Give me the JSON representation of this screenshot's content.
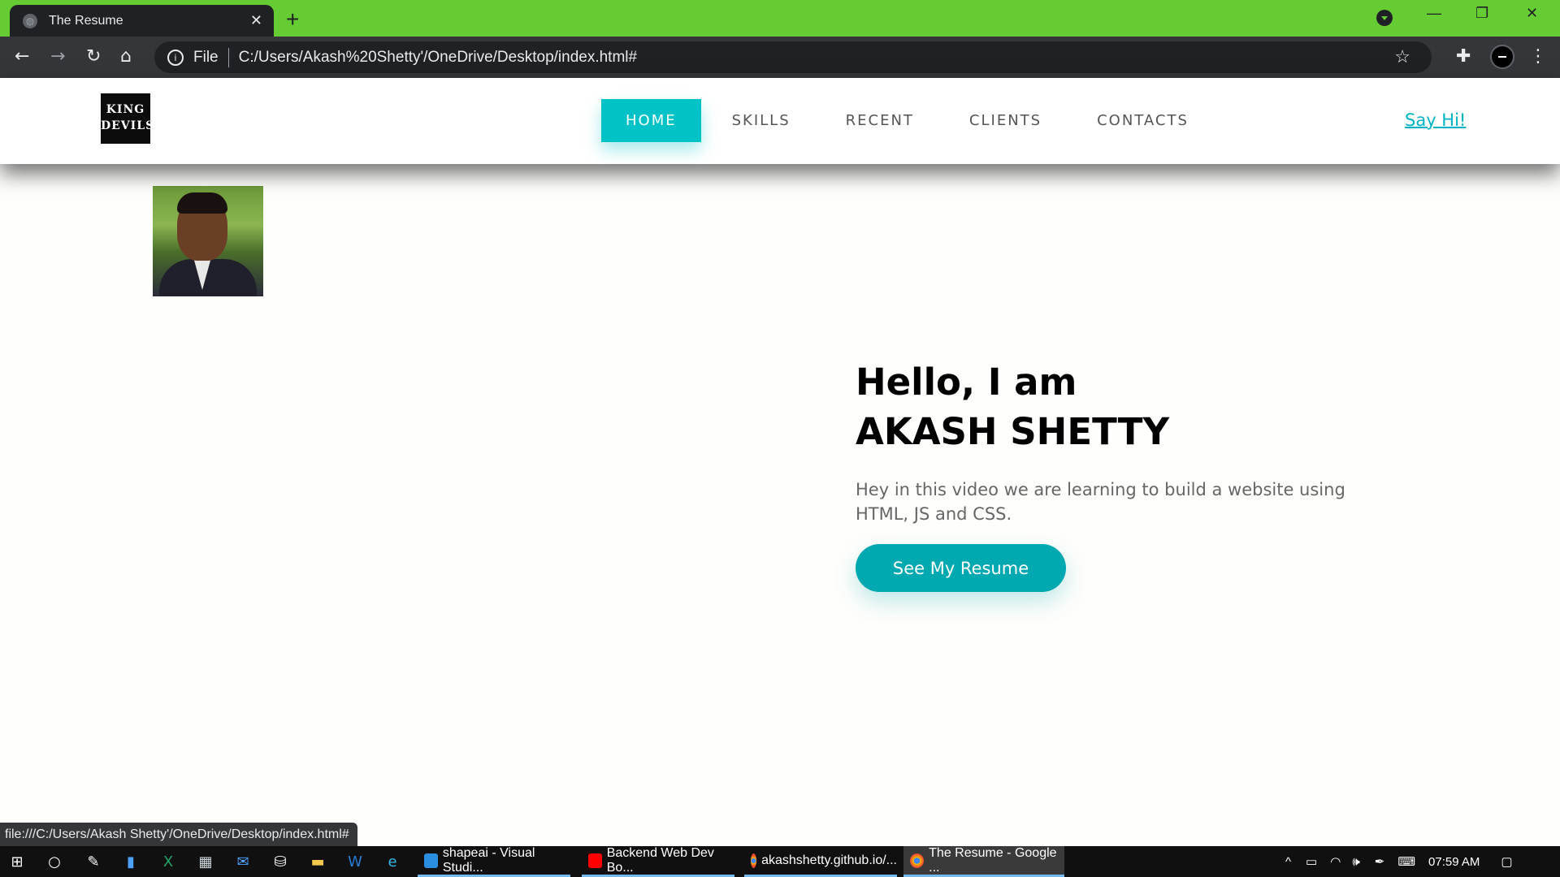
{
  "browser": {
    "tab_title": "The Resume",
    "tab_close": "✕",
    "new_tab": "+",
    "omnibox_scheme": "File",
    "url": "C:/Users/Akash%20Shetty'/OneDrive/Desktop/index.html#",
    "status_url": "file:///C:/Users/Akash Shetty'/OneDrive/Desktop/index.html#",
    "accent_color": "#66cc33"
  },
  "site": {
    "logo_line1": "KING",
    "logo_line2": "DEVILS",
    "nav": [
      {
        "label": "HOME",
        "active": true
      },
      {
        "label": "SKILLS",
        "active": false
      },
      {
        "label": "RECENT",
        "active": false
      },
      {
        "label": "CLIENTS",
        "active": false
      },
      {
        "label": "CONTACTS",
        "active": false
      }
    ],
    "say_hi": "Say Hi!",
    "accent_color": "#00c2c7"
  },
  "hero": {
    "greeting_line1": "Hello, I am",
    "greeting_line2": "AKASH SHETTY",
    "description": "Hey in this video we are learning to build a website using HTML, JS and CSS.",
    "cta_label": "See My Resume",
    "cta_color": "#00a8b0"
  },
  "taskbar": {
    "tasks": [
      {
        "label": "shapeai - Visual Studi...",
        "icon": "vscode-icon",
        "active": false
      },
      {
        "label": "Backend Web Dev Bo...",
        "icon": "youtube-icon",
        "active": false
      },
      {
        "label": "akashshetty.github.io/...",
        "icon": "chrome-icon",
        "active": false
      },
      {
        "label": "The Resume - Google ...",
        "icon": "chrome-icon",
        "active": true
      }
    ],
    "time": "07:59 AM"
  }
}
